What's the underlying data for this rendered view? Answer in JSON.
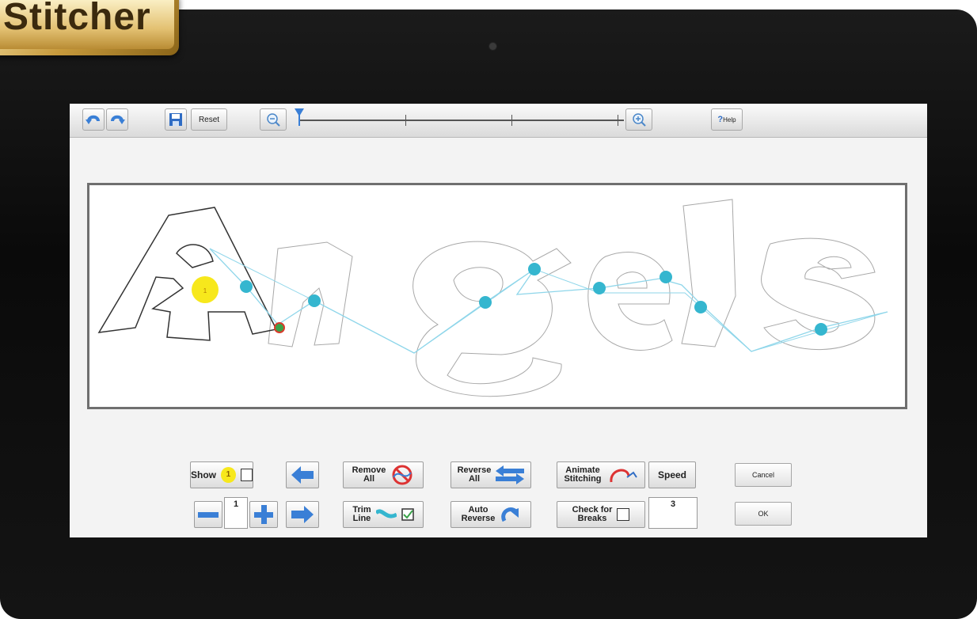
{
  "brand": {
    "logo_text": "Stitcher"
  },
  "toolbar": {
    "undo_icon": "undo-icon",
    "redo_icon": "redo-icon",
    "save_icon": "save-icon",
    "reset_label": "Reset",
    "zoom_out_icon": "zoom-out-icon",
    "zoom_in_icon": "zoom-in-icon",
    "zoom_level": 0,
    "help_label": "Help"
  },
  "canvas": {
    "word": "Angels",
    "start_marker_label": "1"
  },
  "controls": {
    "show_label": "Show",
    "show_badge": "1",
    "show_checked": false,
    "step_value": "1",
    "remove_all_label": [
      "Remove",
      "All"
    ],
    "trim_line_label": [
      "Trim",
      "Line"
    ],
    "trim_line_checked": true,
    "reverse_all_label": [
      "Reverse",
      "All"
    ],
    "auto_reverse_label": [
      "Auto",
      "Reverse"
    ],
    "animate_label": [
      "Animate",
      "Stitching"
    ],
    "speed_label": "Speed",
    "check_breaks_label": [
      "Check for",
      "Breaks"
    ],
    "check_breaks_checked": false,
    "breaks_value": "3",
    "cancel_label": "Cancel",
    "ok_label": "OK"
  },
  "colors": {
    "accent_blue": "#3a7fd6",
    "stitch_line": "#8fd6ea",
    "stitch_node": "#35b6cf",
    "start_marker": "#f7e81c"
  }
}
